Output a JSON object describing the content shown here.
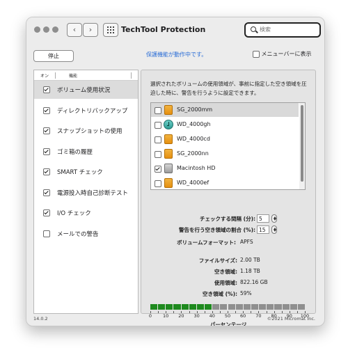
{
  "window": {
    "title": "TechTool Protection",
    "search_placeholder": "検索"
  },
  "toolbar": {
    "stop_label": "停止",
    "status": "保護機能が動作中です。",
    "menubar_label": "メニューバーに表示",
    "menubar_checked": false
  },
  "functions": {
    "header_on": "オン",
    "header_function": "機能",
    "items": [
      {
        "label": "ボリューム使用状況",
        "checked": true,
        "selected": true
      },
      {
        "label": "ディレクトリバックアップ",
        "checked": true,
        "selected": false
      },
      {
        "label": "スナップショットの使用",
        "checked": true,
        "selected": false
      },
      {
        "label": "ゴミ箱の履歴",
        "checked": true,
        "selected": false
      },
      {
        "label": "SMART チェック",
        "checked": true,
        "selected": false
      },
      {
        "label": "電源投入時自己診断テスト",
        "checked": true,
        "selected": false
      },
      {
        "label": "I/O チェック",
        "checked": true,
        "selected": false
      },
      {
        "label": "メールでの警告",
        "checked": false,
        "selected": false
      }
    ]
  },
  "detail": {
    "description": "選択されたボリュームの使用領域が、事前に指定した空き領域を圧迫した時に、警告を行うように設定できます。",
    "volumes": [
      {
        "name": "SG_2000mm",
        "checked": false,
        "icon": "orange-disk-icon",
        "selected": true
      },
      {
        "name": "WD_4000gh",
        "checked": false,
        "icon": "time-machine-disk-icon",
        "selected": false
      },
      {
        "name": "WD_4000cd",
        "checked": false,
        "icon": "orange-disk-icon",
        "selected": false
      },
      {
        "name": "SG_2000nn",
        "checked": false,
        "icon": "orange-disk-icon",
        "selected": false
      },
      {
        "name": "Macintosh HD",
        "checked": true,
        "icon": "gray-disk-icon",
        "selected": false
      },
      {
        "name": "WD_4000ef",
        "checked": false,
        "icon": "orange-disk-icon",
        "selected": false
      }
    ],
    "check_interval_label": "チェックする間隔 (分):",
    "check_interval_value": "5",
    "warn_ratio_label": "警告を行う空き領域の割合 (%):",
    "warn_ratio_value": "15",
    "format_label": "ボリュームフォーマット:",
    "format_value": "APFS",
    "file_size_label": "ファイルサイズ:",
    "file_size_value": "2.00 TB",
    "free_label": "空き領域:",
    "free_value": "1.18 TB",
    "used_label": "使用領域:",
    "used_value": "822.16 GB",
    "free_pct_label": "空き領域 (%):",
    "free_pct_value": "59%",
    "usage_percent": 41,
    "bar_fill_color": "#1e8a1e",
    "bar_empty_color": "#8f8f8f",
    "tick_labels": [
      "0",
      "10",
      "20",
      "30",
      "40",
      "50",
      "60",
      "70",
      "80",
      "90",
      "100"
    ],
    "axis_label": "パーセンテージ"
  },
  "footer": {
    "version": "14.0.2",
    "copyright": "©2021 Micromat Inc."
  }
}
